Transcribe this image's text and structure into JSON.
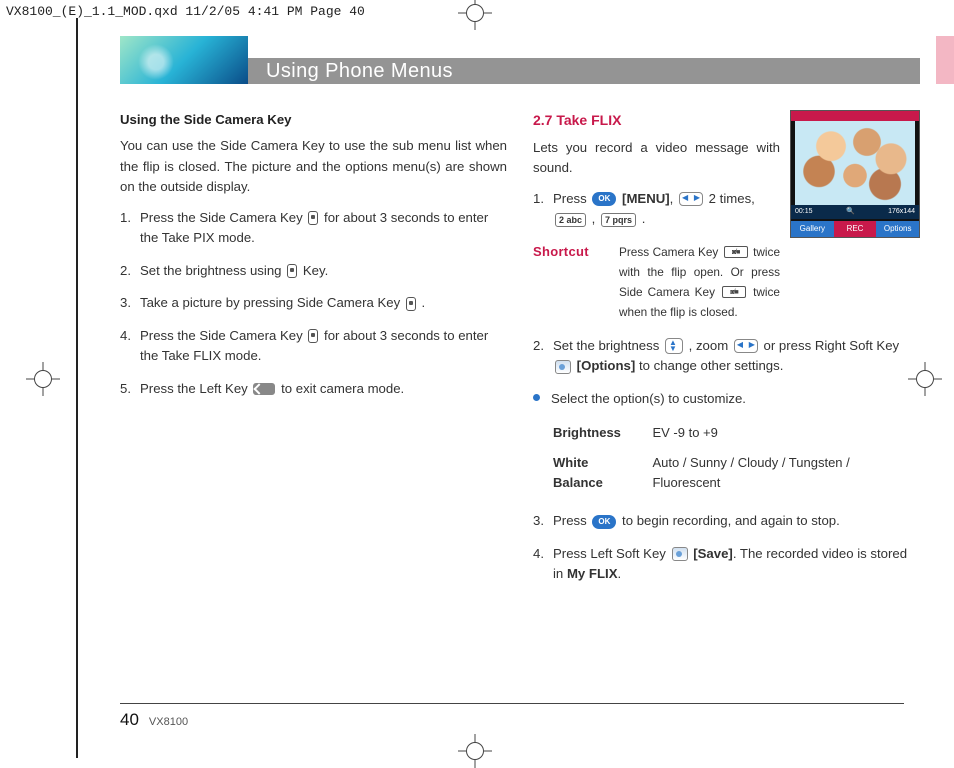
{
  "meta": {
    "headerline": "VX8100_(E)_1.1_MOD.qxd  11/2/05  4:41 PM  Page 40"
  },
  "banner": {
    "title": "Using Phone Menus"
  },
  "left": {
    "heading": "Using the Side Camera Key",
    "intro": "You can use the Side Camera Key      to use the sub menu list when the flip is closed. The picture and the options menu(s) are shown on the outside display.",
    "s1a": "Press the Side Camera Key ",
    "s1b": " for about 3 seconds to enter the Take PIX mode.",
    "s2a": "Set the brightness using ",
    "s2b": " Key.",
    "s3a": "Take a picture by pressing Side Camera Key ",
    "s3b": " .",
    "s4a": "Press the Side Camera Key ",
    "s4b": " for about 3 seconds to enter the Take FLIX mode.",
    "s5a": "Press the Left Key ",
    "s5b": " to exit camera mode."
  },
  "right": {
    "section": "2.7 Take FLIX",
    "intro": "Lets you record a video message with sound.",
    "s1a": "Press ",
    "s1menu": "[MENU]",
    "s1b": ", ",
    "s1c": " 2 times, ",
    "s1d": " , ",
    "s1e": " .",
    "key2": "2 abc",
    "key7": "7 pqrs",
    "shortcut_label": "Shortcut",
    "shortcut_a": "Press Camera Key ",
    "shortcut_b": " twice with the flip open. Or press Side Camera Key ",
    "shortcut_c": " twice when the flip is closed.",
    "s2a": "Set the brightness ",
    "s2b": " , zoom ",
    "s2c": " or press Right Soft Key ",
    "s2opt": "[Options]",
    "s2d": " to change other settings.",
    "bullet": "Select the option(s) to customize.",
    "tbl": {
      "brightness_k": "Brightness",
      "brightness_v": "EV -9  to  +9",
      "wb_k": "White Balance",
      "wb_v": "Auto / Sunny / Cloudy / Tungsten / Fluorescent"
    },
    "s3a": "Press ",
    "s3b": " to begin recording, and again to stop.",
    "s4a": "Press Left Soft Key ",
    "s4save": "[Save]",
    "s4b": ". The recorded video is stored in ",
    "s4c": "My FLIX",
    "s4d": "."
  },
  "phone": {
    "time": "00:15",
    "res": "176x144",
    "gallery": "Gallery",
    "rec": "REC",
    "options": "Options"
  },
  "footer": {
    "page": "40",
    "model": "VX8100"
  },
  "ok_label": "OK"
}
